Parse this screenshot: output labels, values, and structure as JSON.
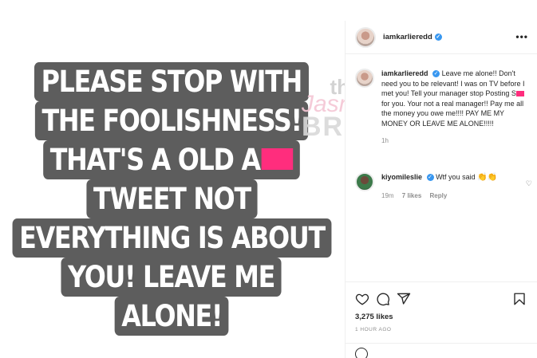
{
  "story": {
    "caption_lines": [
      "PLEASE STOP WITH",
      "THE FOOLISHNESS!",
      "THAT'S A OLD A",
      "TWEET NOT",
      "EVERYTHING IS ABOUT",
      "YOU! LEAVE ME",
      "ALONE!"
    ],
    "censor_color": "#ff2d7d",
    "caption_bg": "#5d5d5d"
  },
  "watermark": {
    "line1": "the",
    "line2": "Jasmine",
    "line3": "BRAND"
  },
  "post": {
    "username": "iamkarlieredd",
    "more_icon": "more-options-icon",
    "caption": {
      "username": "iamkarlieredd",
      "text_before": "Leave me alone!! Don't need you to be relevant! I was on TV before I met you! Tell your manager stop Posting S",
      "text_after": " for you. Your not a real manager!! Pay me all the money you owe me!!!! PAY ME MY MONEY OR LEAVE ME ALONE!!!!!",
      "time": "1h"
    },
    "reply": {
      "username": "kiyomileslie",
      "text": "Wtf you said",
      "emoji": "👏",
      "time": "19m",
      "likes": "7 likes",
      "reply_label": "Reply"
    },
    "likes": "3,275 likes",
    "posted_ago": "1 HOUR AGO",
    "verified_color": "#3897f0"
  }
}
